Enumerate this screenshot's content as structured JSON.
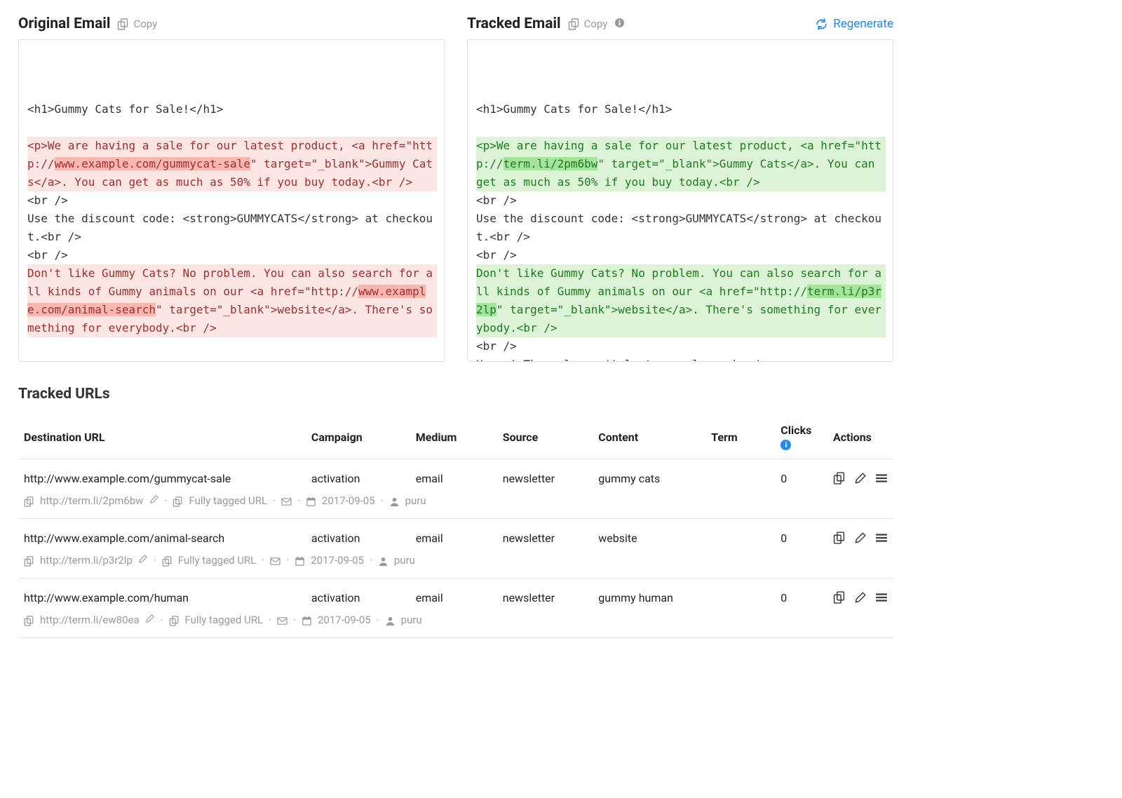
{
  "panels": {
    "original": {
      "title": "Original Email",
      "copy_label": "Copy",
      "code": [
        {
          "t": "",
          "cls": "blank"
        },
        {
          "t": "<h1>Gummy Cats for Sale!</h1>",
          "cls": ""
        },
        {
          "t": "",
          "cls": "blank"
        },
        {
          "pre": "<p>We are having a sale for our latest product, <a href=\"http://",
          "hl": "www.example.com/gummycat-sale",
          "post": "\" target=\"_blank\">Gummy Cats</a>. You can get as much as 50% if you buy today.<br />",
          "cls": "diff-del"
        },
        {
          "t": "<br />",
          "cls": ""
        },
        {
          "t": "Use the discount code: <strong>GUMMYCATS</strong> at checkout.<br />",
          "cls": ""
        },
        {
          "t": "<br />",
          "cls": ""
        },
        {
          "pre": "Don't like Gummy Cats? No problem. You can also search for all kinds of Gummy animals on our <a href=\"http://",
          "hl": "www.example.com/animal-search",
          "post": "\" target=\"_blank\">website</a>. There's something for everybody.<br />",
          "cls": "diff-del"
        }
      ]
    },
    "tracked": {
      "title": "Tracked Email",
      "copy_label": "Copy",
      "regenerate_label": "Regenerate",
      "code": [
        {
          "t": "",
          "cls": "blank"
        },
        {
          "t": "<h1>Gummy Cats for Sale!</h1>",
          "cls": ""
        },
        {
          "t": "",
          "cls": "blank"
        },
        {
          "pre": "<p>We are having a sale for our latest product, <a href=\"http://",
          "hl": "term.li/2pm6bw",
          "post": "\" target=\"_blank\">Gummy Cats</a>. You can get as much as 50% if you buy today.<br />",
          "cls": "diff-add"
        },
        {
          "t": "<br />",
          "cls": ""
        },
        {
          "t": "Use the discount code: <strong>GUMMYCATS</strong> at checkout.<br />",
          "cls": ""
        },
        {
          "t": "<br />",
          "cls": ""
        },
        {
          "pre": "Don't like Gummy Cats? No problem. You can also search for all kinds of Gummy animals on our <a href=\"http://",
          "hl": "term.li/p3r2lp",
          "post": "\" target=\"_blank\">website</a>. There's something for everybody.<br />",
          "cls": "diff-add"
        },
        {
          "t": "<br />",
          "cls": ""
        },
        {
          "t": "Hurry! The sale won't last very long.<br />",
          "cls": ""
        }
      ]
    }
  },
  "tracked_section_title": "Tracked URLs",
  "columns": {
    "destination": "Destination URL",
    "campaign": "Campaign",
    "medium": "Medium",
    "source": "Source",
    "content": "Content",
    "term": "Term",
    "clicks": "Clicks",
    "actions": "Actions"
  },
  "rows": [
    {
      "destination": "http://www.example.com/gummycat-sale",
      "campaign": "activation",
      "medium": "email",
      "source": "newsletter",
      "content": "gummy cats",
      "term": "",
      "clicks": "0",
      "short": "http://term.li/2pm6bw",
      "tag_status": "Fully tagged URL",
      "date": "2017-09-05",
      "user": "puru"
    },
    {
      "destination": "http://www.example.com/animal-search",
      "campaign": "activation",
      "medium": "email",
      "source": "newsletter",
      "content": "website",
      "term": "",
      "clicks": "0",
      "short": "http://term.li/p3r2lp",
      "tag_status": "Fully tagged URL",
      "date": "2017-09-05",
      "user": "puru"
    },
    {
      "destination": "http://www.example.com/human",
      "campaign": "activation",
      "medium": "email",
      "source": "newsletter",
      "content": "gummy human",
      "term": "",
      "clicks": "0",
      "short": "http://term.li/ew80ea",
      "tag_status": "Fully tagged URL",
      "date": "2017-09-05",
      "user": "puru"
    }
  ]
}
